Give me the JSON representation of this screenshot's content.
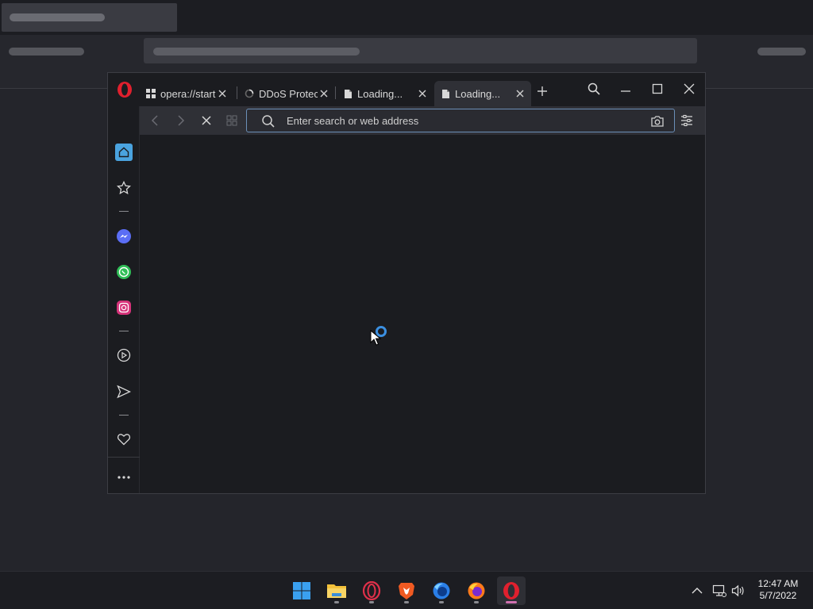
{
  "browser": {
    "tabs": [
      {
        "label": "opera://startp",
        "icon": "grid-icon"
      },
      {
        "label": "DDoS Protect",
        "icon": "loading-spinner-icon"
      },
      {
        "label": "Loading...",
        "icon": "document-icon"
      },
      {
        "label": "Loading...",
        "icon": "document-icon",
        "active": true
      }
    ],
    "address_placeholder": "Enter search or web address",
    "accent_color": "#3b8fe0"
  },
  "sidebar": {
    "items": [
      "home-icon",
      "bookmarks-icon",
      "messenger-icon",
      "whatsapp-icon",
      "instagram-icon",
      "player-icon",
      "flow-icon",
      "my-flow-heart-icon",
      "more-icon"
    ]
  },
  "taskbar": {
    "apps": [
      "windows-start-icon",
      "file-explorer-icon",
      "opera-gx-icon",
      "brave-icon",
      "firefox-developer-icon",
      "firefox-icon",
      "opera-icon"
    ],
    "clock": {
      "time": "12:47 AM",
      "date": "5/7/2022"
    }
  }
}
